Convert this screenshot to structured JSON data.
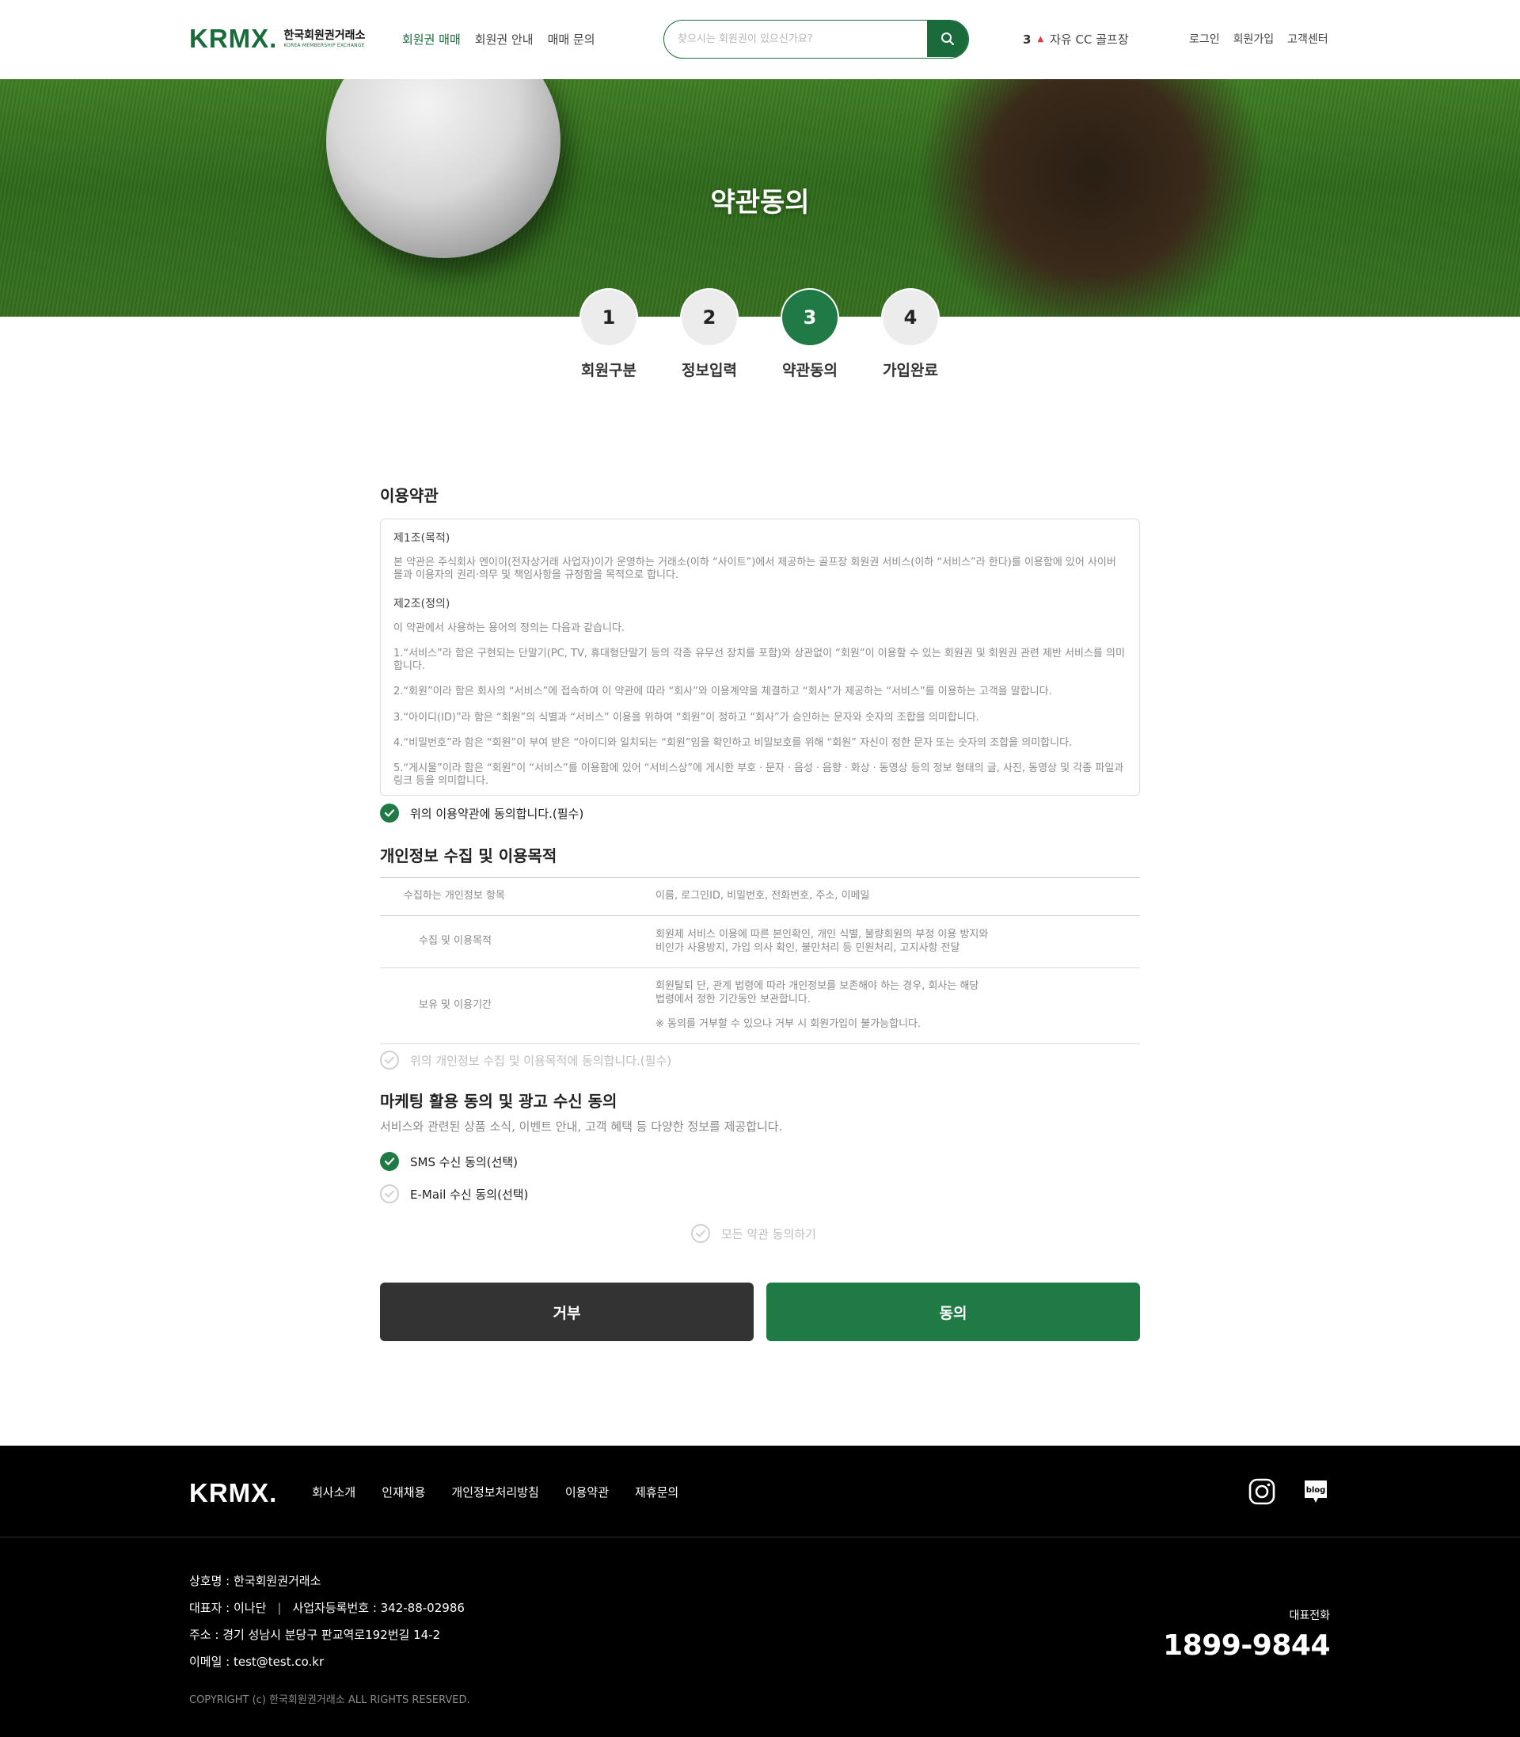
{
  "header": {
    "logo_mark": "KRMX.",
    "logo_ko": "한국회원권거래소",
    "logo_en": "KOREA MEMBERSHIP EXCHANGE",
    "nav": [
      "회원권 매매",
      "회원권 안내",
      "매매 문의"
    ],
    "search_placeholder": "찾으시는 회원권이 있으신가요?",
    "rank": {
      "num": "3",
      "name": "자유 CC 골프장",
      "trend": "up"
    },
    "util": [
      "로그인",
      "회원가입",
      "고객센터"
    ]
  },
  "hero": {
    "title": "약관동의"
  },
  "steps": [
    {
      "num": "1",
      "label": "회원구분"
    },
    {
      "num": "2",
      "label": "정보입력"
    },
    {
      "num": "3",
      "label": "약관동의",
      "active": true
    },
    {
      "num": "4",
      "label": "가입완료"
    }
  ],
  "terms": {
    "title": "이용약관",
    "art1_title": "제1조(목적)",
    "art1_body": "본 약관은 주식회사 엔이이(전자상거래 사업자)이가 운영하는 거래소(이하 “사이트”)에서 제공하는 골프장 회원권 서비스(이하 “서비스”라 한다)를 이용함에 있어 사이버 몰과 이용자의 권리·의무 및 책임사항을 규정함을 목적으로 합니다.",
    "art2_title": "제2조(정의)",
    "art2_items": [
      "이 약관에서 사용하는 용어의 정의는 다음과 같습니다.",
      "1.“서비스”라 함은 구현되는 단말기(PC, TV, 휴대형단말기 등의 각종 유무선 장치를 포함)와 상관없이 “회원”이 이용할 수 있는 회원권 및 회원권 관련 제반 서비스를 의미합니다.",
      "2.“회원”이라 함은 회사의 “서비스”에 접속하여 이 약관에 따라 “회사”와 이용계약을 체결하고 “회사”가 제공하는 “서비스”를 이용하는 고객을 말합니다.",
      "3.“아이디(ID)”라 함은 “회원”의 식별과 “서비스” 이용을 위하여 “회원”이 정하고 “회사”가 승인하는 문자와 숫자의 조합을 의미합니다.",
      "4.“비밀번호”라 함은 “회원”이 부여 받은 “아이디와 일치되는 “회원”임을 확인하고 비밀보호를 위해 “회원” 자신이 정한 문자 또는 숫자의 조합을 의미합니다.",
      "5.“게시물”이라 함은 “회원”이 “서비스”를 이용함에 있어 “서비스상”에 게시한 부호ㆍ문자ㆍ음성ㆍ음향ㆍ화상ㆍ동영상 등의 정보 형태의 글, 사진, 동영상 및 각종 파일과 링크 등을 의미합니다."
    ],
    "agree_label": "위의 이용약관에 동의합니다.(필수)",
    "agree_checked": true
  },
  "privacy": {
    "title": "개인정보 수집 및 이용목적",
    "rows": [
      {
        "k": "수집하는 개인정보 항목",
        "v": [
          "이름, 로그인ID, 비밀번호, 전화번호, 주소, 이메일"
        ]
      },
      {
        "k": "수집 및 이용목적",
        "v": [
          "회원제 서비스 이용에 따른 본인확인, 개인 식별, 불량회원의 부정 이용 방지와",
          "비인가 사용방지, 가입 의사 확인, 불만처리 등 민원처리, 고지사항 전달"
        ]
      },
      {
        "k": "보유 및 이용기간",
        "v": [
          "회원탈퇴 단, 관계 법령에 따라 개인정보를 보존해야 하는 경우, 회사는 해당",
          "법령에서 정한 기간동안 보관합니다."
        ],
        "note": "※ 동의를 거부할 수 있으나 거부 시 회원가입이 불가능합니다."
      }
    ],
    "agree_label": "위의 개인정보 수집 및 이용목적에 동의합니다.(필수)",
    "agree_checked": false
  },
  "marketing": {
    "title": "마케팅 활용 동의 및 광고 수신 동의",
    "desc": "서비스와 관련된 상품 소식, 이벤트 안내, 고객 혜택 등 다양한 정보를 제공합니다.",
    "sms_label": "SMS 수신 동의(선택)",
    "sms_checked": true,
    "email_label": "E-Mail 수신 동의(선택)",
    "email_checked": false
  },
  "all_agree": {
    "label": "모든 약관 동의하기",
    "checked": false
  },
  "buttons": {
    "reject": "거부",
    "agree": "동의"
  },
  "footer": {
    "logo": "KRMX.",
    "nav": [
      "회사소개",
      "인재채용",
      "개인정보처리방침",
      "이용약관",
      "제휴문의"
    ],
    "blog_label": "blog",
    "company": "상호명 : 한국회원권거래소",
    "ceo": "대표자 : 이나단",
    "bizno": "사업자등록번호 : 342-88-02986",
    "address": "주소 : 경기 성남시 분당구 판교역로192번길 14-2",
    "email": "이메일 : test@test.co.kr",
    "copyright": "COPYRIGHT (c) 한국회원권거래소 ALL RIGHTS RESERVED.",
    "phone_label": "대표전화",
    "phone": "1899-9844"
  },
  "colors": {
    "brand": "#1f7a46",
    "dark_button": "#333333",
    "footer_bg": "#000000"
  }
}
